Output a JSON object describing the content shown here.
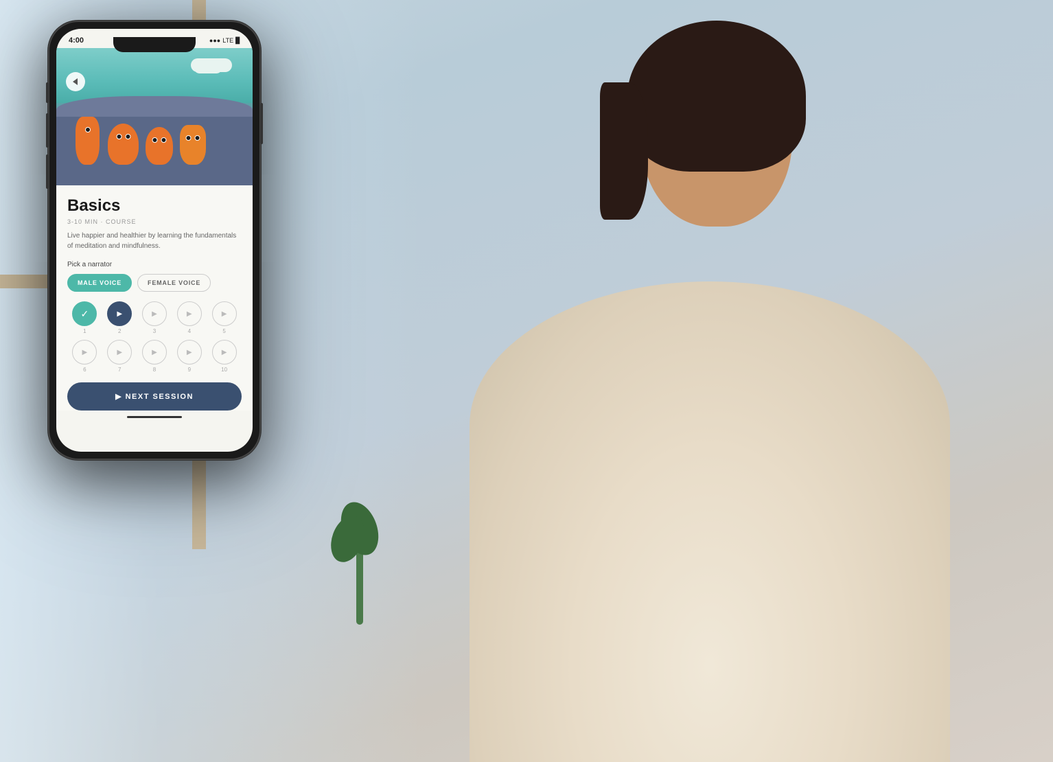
{
  "background": {
    "alt_text": "Woman sitting on couch looking at phone"
  },
  "phone": {
    "status_bar": {
      "time": "4:00",
      "signal": "●●●",
      "network": "LTE",
      "battery": "▉"
    },
    "hero": {
      "back_button_label": "‹"
    },
    "course": {
      "title": "Basics",
      "meta": "3-10 MIN · COURSE",
      "description": "Live happier and healthier by learning the fundamentals of meditation and mindfulness."
    },
    "narrator": {
      "label": "Pick a narrator",
      "options": [
        {
          "id": "male",
          "label": "MALE VOICE",
          "active": true
        },
        {
          "id": "female",
          "label": "FEMALE VOICE",
          "active": false
        }
      ]
    },
    "sessions": [
      {
        "number": "1",
        "state": "completed"
      },
      {
        "number": "2",
        "state": "active"
      },
      {
        "number": "3",
        "state": "locked"
      },
      {
        "number": "4",
        "state": "locked"
      },
      {
        "number": "5",
        "state": "locked"
      },
      {
        "number": "6",
        "state": "locked"
      },
      {
        "number": "7",
        "state": "locked"
      },
      {
        "number": "8",
        "state": "locked"
      },
      {
        "number": "9",
        "state": "locked"
      },
      {
        "number": "10",
        "state": "locked"
      }
    ],
    "next_session_button": "▶  NEXT SESSION",
    "home_indicator": true
  },
  "colors": {
    "teal": "#4db8a8",
    "dark_blue": "#3a5070",
    "orange": "#e8732a",
    "light_bg": "#f8f8f4"
  }
}
